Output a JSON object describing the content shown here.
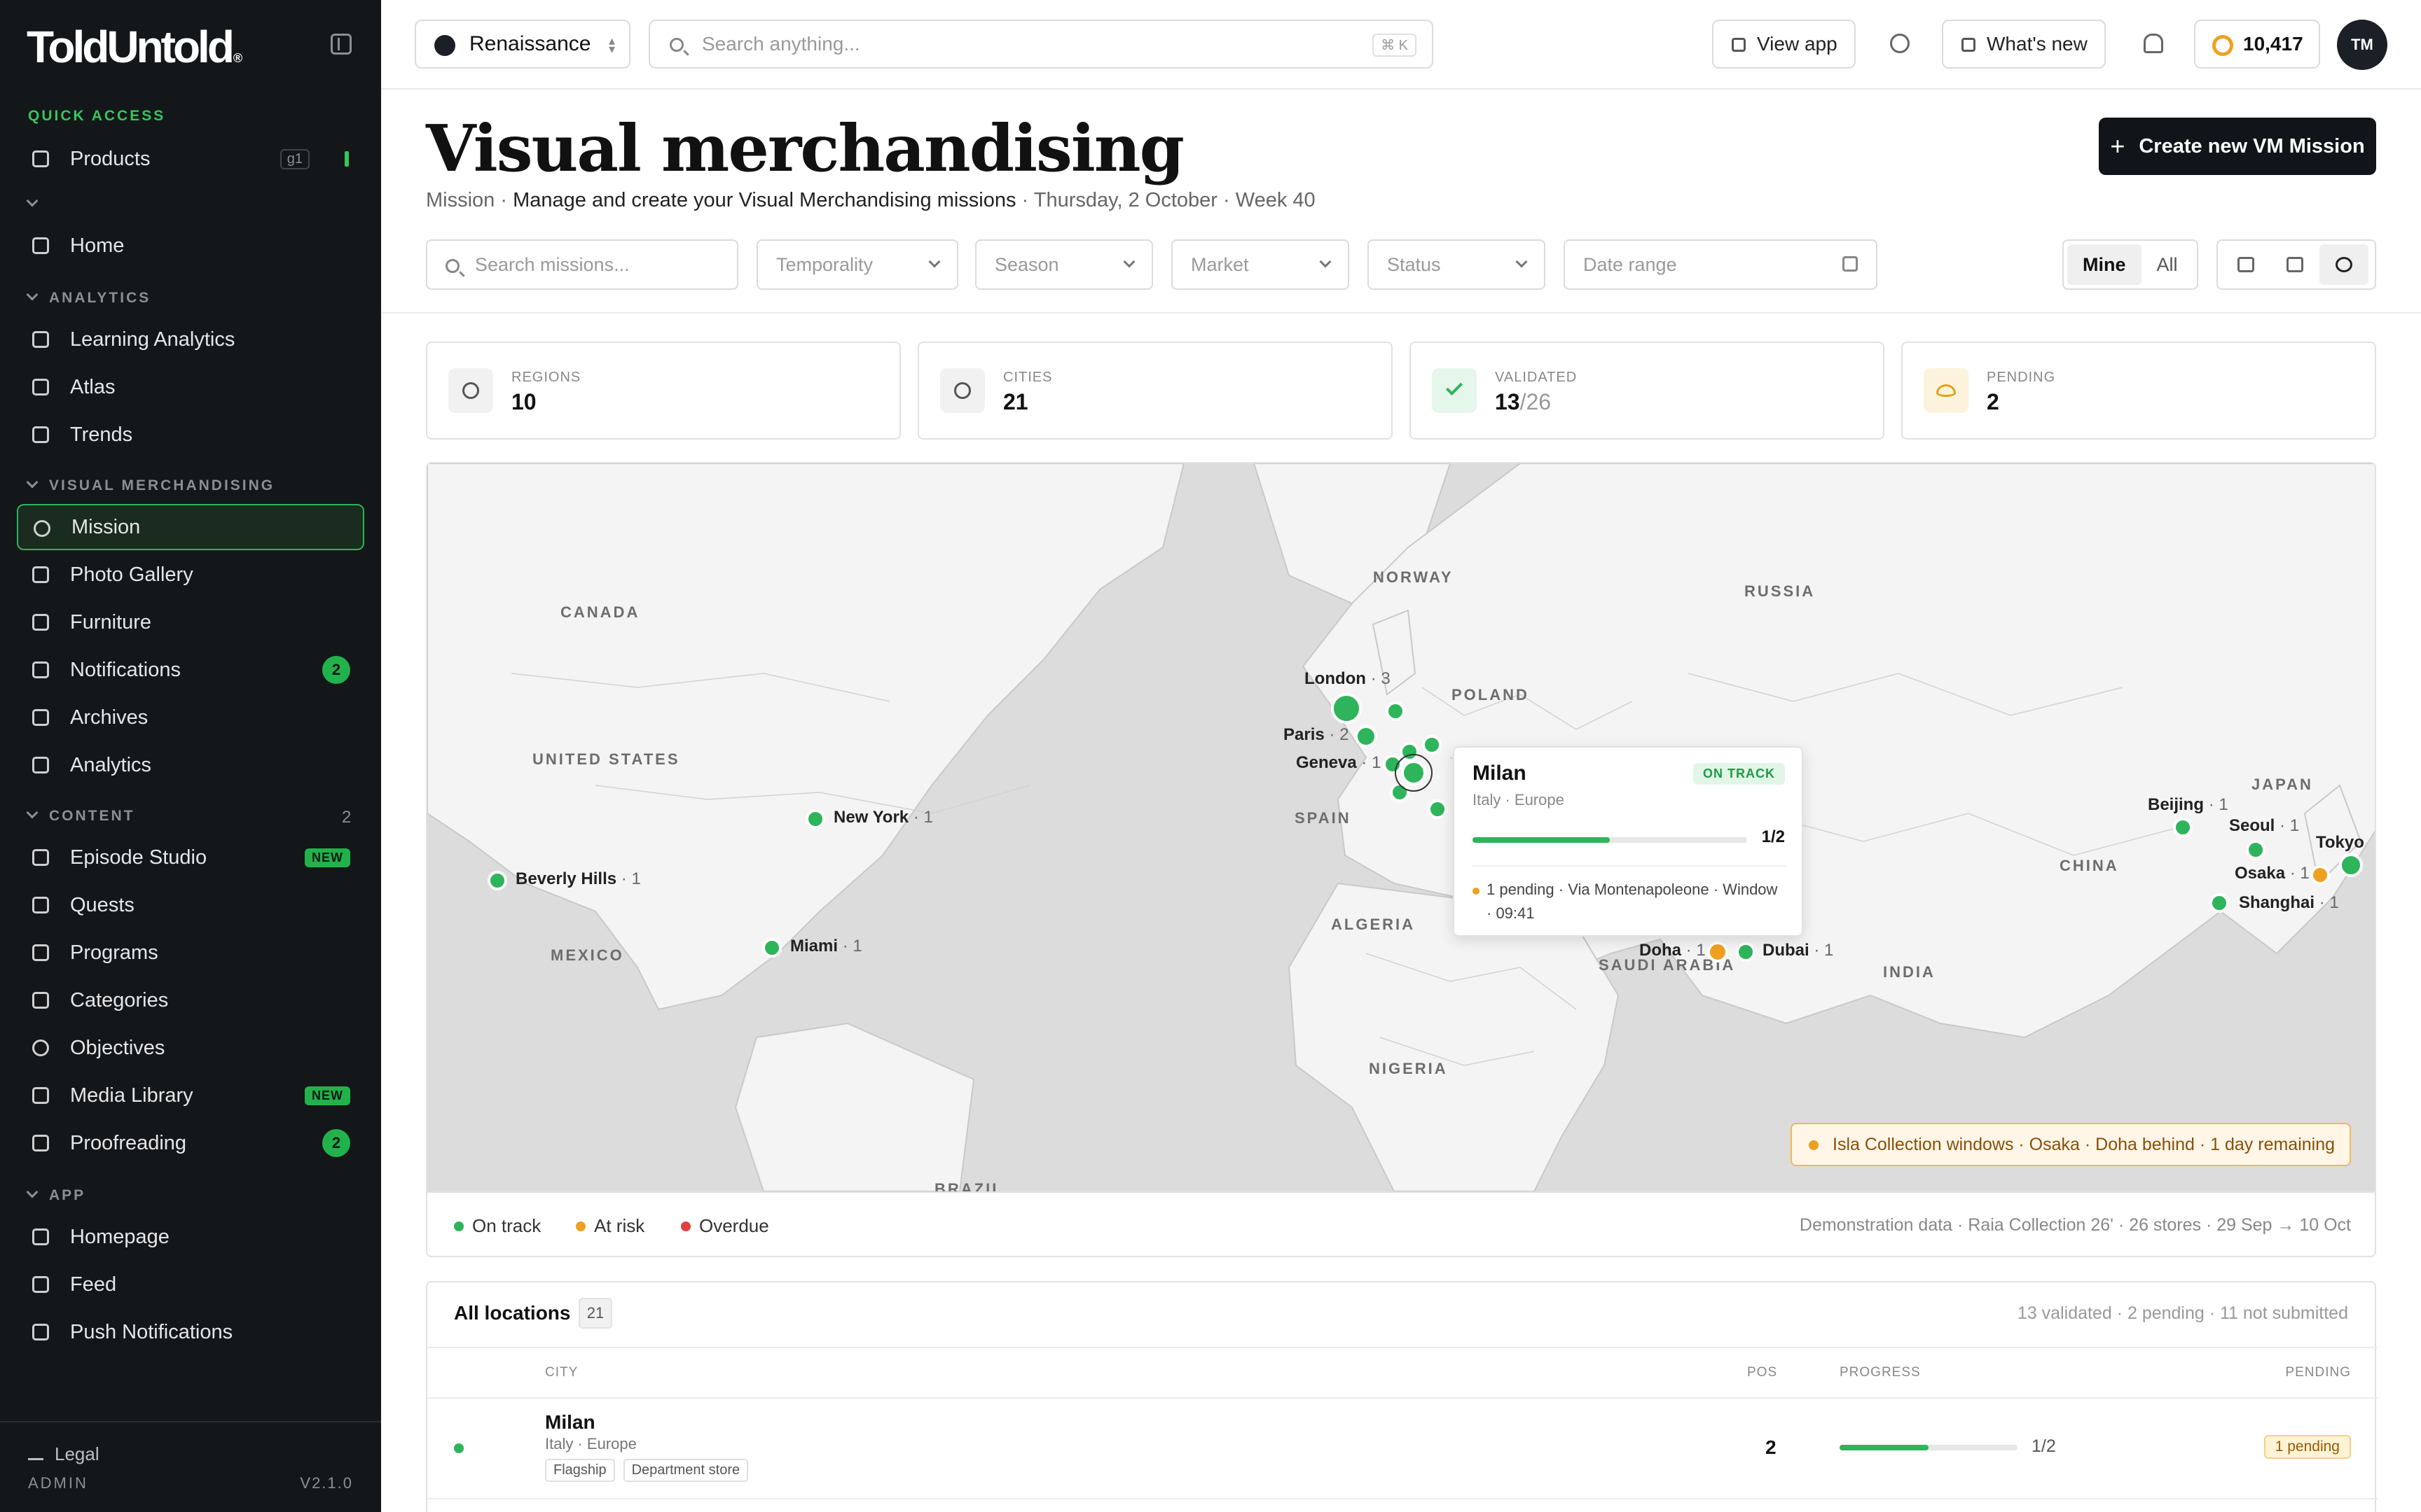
{
  "sidebar": {
    "logo": "ToldUntold",
    "logo_mark": "®",
    "quick_access_label": "QUICK ACCESS",
    "products": {
      "label": "Products",
      "shortcut": "g1"
    },
    "home": "Home",
    "analytics_label": "ANALYTICS",
    "analytics_items": [
      "Learning Analytics",
      "Atlas",
      "Trends"
    ],
    "vm_label": "VISUAL MERCHANDISING",
    "vm_items": [
      {
        "label": "Mission",
        "active": true
      },
      {
        "label": "Photo Gallery"
      },
      {
        "label": "Furniture"
      },
      {
        "label": "Notifications",
        "badge": "2"
      },
      {
        "label": "Archives"
      },
      {
        "label": "Analytics"
      }
    ],
    "content_label": "CONTENT",
    "content_count": "2",
    "content_items": [
      {
        "label": "Episode Studio",
        "tag": "NEW"
      },
      {
        "label": "Quests"
      },
      {
        "label": "Programs"
      },
      {
        "label": "Categories"
      },
      {
        "label": "Objectives"
      },
      {
        "label": "Media Library",
        "tag": "NEW"
      },
      {
        "label": "Proofreading",
        "badge": "2"
      }
    ],
    "app_label": "APP",
    "app_items": [
      "Homepage",
      "Feed",
      "Push Notifications"
    ],
    "legal": "Legal",
    "role": "ADMIN",
    "version": "V2.1.0"
  },
  "topbar": {
    "workspace": "Renaissance",
    "search_placeholder": "Search anything...",
    "search_shortcut": "⌘ K",
    "view_app": "View app",
    "whats_new": "What's new",
    "coins": "10,417",
    "avatar": "TM"
  },
  "page": {
    "title": "Visual merchandising",
    "subtitle_section": "Mission",
    "subtitle_desc": "Manage and create your Visual Merchandising missions",
    "subtitle_date": "Thursday, 2 October",
    "subtitle_week": "Week 40",
    "create_button": "Create new VM Mission"
  },
  "filters": {
    "search_placeholder": "Search missions...",
    "temporality": "Temporality",
    "season": "Season",
    "market": "Market",
    "status": "Status",
    "date_range": "Date range",
    "scope_options": [
      "Mine",
      "All"
    ],
    "scope_selected": "Mine",
    "view_selected": "map"
  },
  "stats": [
    {
      "label": "REGIONS",
      "value": "10",
      "icon": "globe-icon"
    },
    {
      "label": "CITIES",
      "value": "21",
      "icon": "pin-icon"
    },
    {
      "label": "VALIDATED",
      "value": "13",
      "of": "/26",
      "icon": "check-icon"
    },
    {
      "label": "PENDING",
      "value": "2",
      "icon": "eye-icon"
    }
  ],
  "map": {
    "countries": [
      "CANADA",
      "UNITED STATES",
      "MEXICO",
      "NORWAY",
      "RUSSIA",
      "POLAND",
      "SPAIN",
      "ALGERIA",
      "NIGERIA",
      "SAUDI ARABIA",
      "INDIA",
      "CHINA",
      "JAPAN",
      "BRAZIL"
    ],
    "cities": [
      {
        "name": "London",
        "count": "3",
        "status": "on-track"
      },
      {
        "name": "Paris",
        "count": "2",
        "status": "on-track"
      },
      {
        "name": "Geneva",
        "count": "1",
        "status": "on-track"
      },
      {
        "name": "New York",
        "count": "1",
        "status": "on-track"
      },
      {
        "name": "Beverly Hills",
        "count": "1",
        "status": "on-track"
      },
      {
        "name": "Miami",
        "count": "1",
        "status": "on-track"
      },
      {
        "name": "Doha",
        "count": "1",
        "status": "at-risk"
      },
      {
        "name": "Dubai",
        "count": "1",
        "status": "on-track"
      },
      {
        "name": "Beijing",
        "count": "1",
        "status": "on-track"
      },
      {
        "name": "Seoul",
        "count": "1",
        "status": "on-track"
      },
      {
        "name": "Osaka",
        "count": "1",
        "status": "at-risk"
      },
      {
        "name": "Shanghai",
        "count": "1",
        "status": "on-track"
      },
      {
        "name": "Tokyo",
        "count": "",
        "status": "on-track"
      }
    ],
    "popup": {
      "city": "Milan",
      "region": "Italy · Europe",
      "status": "ON TRACK",
      "progress": 0.5,
      "fraction": "1/2",
      "note": "1 pending · Via Montenapoleone · Window · 09:41"
    },
    "alert": "Isla Collection windows · Osaka · Doha behind · 1 day remaining",
    "legend": [
      {
        "label": "On track",
        "color": "#2eb45a"
      },
      {
        "label": "At risk",
        "color": "#f0a020"
      },
      {
        "label": "Overdue",
        "color": "#e04040"
      }
    ],
    "note": "Demonstration data · Raia Collection 26' · 26 stores · 29 Sep → 10 Oct",
    "colors": {
      "on_track": "#2eb45a",
      "at_risk": "#f0a020",
      "overdue": "#e04040"
    }
  },
  "locations": {
    "title": "All locations",
    "count": "21",
    "summary": "13 validated · 2 pending · 11 not submitted",
    "columns": {
      "city": "CITY",
      "pos": "POS",
      "progress": "PROGRESS",
      "pending": "PENDING"
    },
    "rows": [
      {
        "city": "Milan",
        "region": "Italy · Europe",
        "tags": [
          "Flagship",
          "Department store"
        ],
        "pos": "2",
        "progress": 0.5,
        "fraction": "1/2",
        "pending": "1 pending"
      }
    ]
  }
}
